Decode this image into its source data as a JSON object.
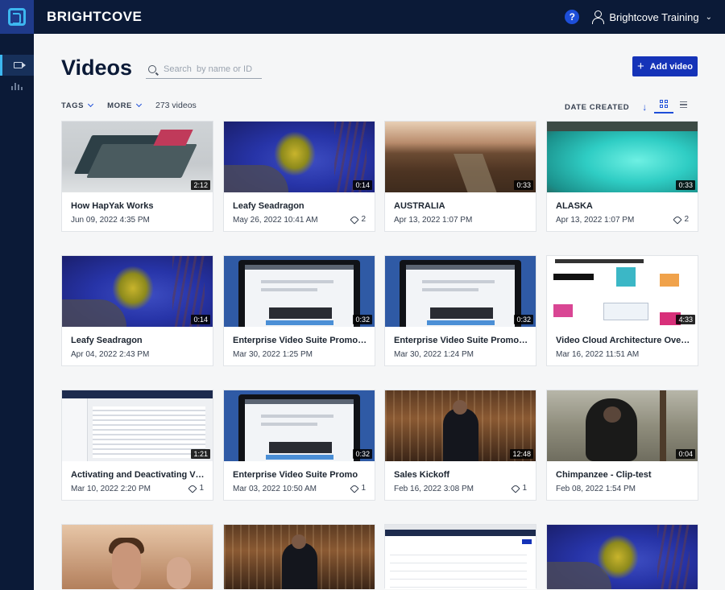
{
  "app": {
    "brand": "BRIGHTCOVE",
    "help_label": "?",
    "user_name": "Brightcove Training"
  },
  "sidebar": {
    "items": [
      {
        "icon": "video-camera-icon",
        "active": true
      },
      {
        "icon": "analytics-icon",
        "active": false
      }
    ]
  },
  "page": {
    "title": "Videos",
    "search_placeholder": "Search  by name or ID",
    "add_button": "Add video",
    "add_icon": "+",
    "filters": {
      "tags": "TAGS",
      "more": "MORE",
      "count": "273 videos"
    },
    "sort": {
      "label": "DATE CREATED",
      "direction_icon": "↓"
    },
    "view_mode": "grid"
  },
  "videos": [
    {
      "title": "How HapYak Works",
      "date": "Jun 09, 2022 4:35 PM",
      "duration": "2:12",
      "tags": "",
      "thumb": "hapyak"
    },
    {
      "title": "Leafy Seadragon",
      "date": "May 26, 2022 10:41 AM",
      "duration": "0:14",
      "tags": "2",
      "thumb": "sea"
    },
    {
      "title": "AUSTRALIA",
      "date": "Apr 13, 2022 1:07 PM",
      "duration": "0:33",
      "tags": "",
      "thumb": "aus"
    },
    {
      "title": "ALASKA",
      "date": "Apr 13, 2022 1:07 PM",
      "duration": "0:33",
      "tags": "2",
      "thumb": "alaska"
    },
    {
      "title": "Leafy Seadragon",
      "date": "Apr 04, 2022 2:43 PM",
      "duration": "0:14",
      "tags": "",
      "thumb": "sea"
    },
    {
      "title": "Enterprise Video Suite Promo Video",
      "date": "Mar 30, 2022 1:25 PM",
      "duration": "0:32",
      "tags": "",
      "thumb": "laptop"
    },
    {
      "title": "Enterprise Video Suite Promo Video",
      "date": "Mar 30, 2022 1:24 PM",
      "duration": "0:32",
      "tags": "",
      "thumb": "laptop"
    },
    {
      "title": "Video Cloud Architecture Overview",
      "date": "Mar 16, 2022 11:51 AM",
      "duration": "4:33",
      "tags": "",
      "thumb": "arch"
    },
    {
      "title": "Activating and Deactivating Videos",
      "date": "Mar 10, 2022 2:20 PM",
      "duration": "1:21",
      "tags": "1",
      "thumb": "screen"
    },
    {
      "title": "Enterprise Video Suite Promo",
      "date": "Mar 03, 2022 10:50 AM",
      "duration": "0:32",
      "tags": "1",
      "thumb": "laptop"
    },
    {
      "title": "Sales Kickoff",
      "date": "Feb 16, 2022 3:08 PM",
      "duration": "12:48",
      "tags": "1",
      "thumb": "stage"
    },
    {
      "title": "Chimpanzee - Clip-test",
      "date": "Feb 08, 2022 1:54 PM",
      "duration": "0:04",
      "tags": "",
      "thumb": "chimp"
    },
    {
      "title": "",
      "date": "",
      "duration": "",
      "tags": "",
      "thumb": "crowd"
    },
    {
      "title": "",
      "date": "",
      "duration": "",
      "tags": "",
      "thumb": "stage"
    },
    {
      "title": "",
      "date": "",
      "duration": "",
      "tags": "",
      "thumb": "players"
    },
    {
      "title": "",
      "date": "",
      "duration": "",
      "tags": "",
      "thumb": "sea"
    }
  ],
  "colors": {
    "topbar": "#0b1a37",
    "accent": "#1533b8",
    "link": "#1d4ed8"
  }
}
